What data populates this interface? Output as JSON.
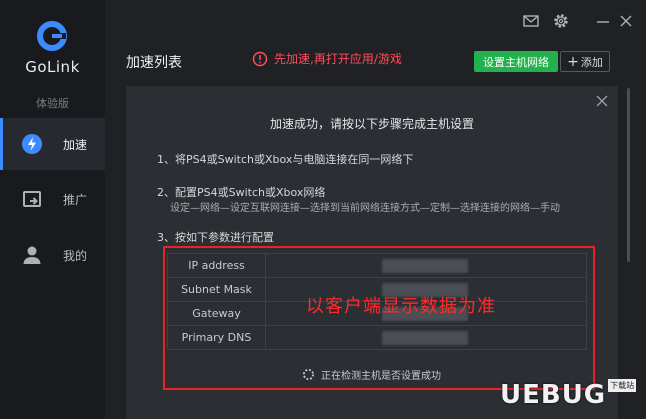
{
  "app": {
    "brand": "GoLink",
    "edition": "体验版",
    "accent": "#3e8bff"
  },
  "sidebar": {
    "items": [
      {
        "label": "加速",
        "icon": "lightning-icon",
        "active": true
      },
      {
        "label": "推广",
        "icon": "share-icon",
        "active": false
      },
      {
        "label": "我的",
        "icon": "user-icon",
        "active": false
      }
    ]
  },
  "window": {
    "controls": [
      "mail-icon",
      "settings-gear-icon",
      "minimize-icon",
      "close-icon"
    ]
  },
  "header": {
    "title": "加速列表",
    "alert": "先加速,再打开应用/游戏",
    "host_button": "设置主机网络",
    "add_button": "添加",
    "add_plus": "+"
  },
  "dialog": {
    "title": "加速成功，请按以下步骤完成主机设置",
    "step1": "1、将PS4或Switch或Xbox与电脑连接在同一网络下",
    "step2": "2、配置PS4或Switch或Xbox网络",
    "step2_sub": "设定—网络—设定互联网连接—选择到当前网络连接方式—定制—选择连接的网络—手动",
    "step3": "3、按如下参数进行配置",
    "table": [
      {
        "key": "IP address"
      },
      {
        "key": "Subnet Mask"
      },
      {
        "key": "Gateway"
      },
      {
        "key": "Primary DNS"
      }
    ],
    "detecting": "正在检测主机是否设置成功"
  },
  "annotation": {
    "text": "以客户端显示数据为准",
    "color": "#e8222b"
  },
  "watermark": {
    "text": "UEBUG",
    "tag": "下载站"
  }
}
